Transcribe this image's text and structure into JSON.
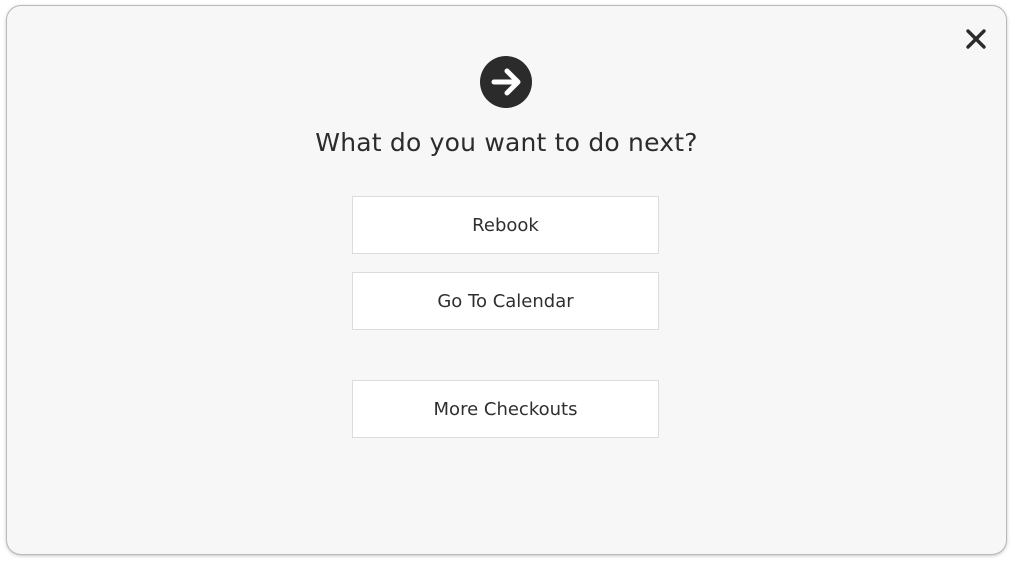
{
  "dialog": {
    "title": "What do you want to do next?",
    "icons": {
      "header": "arrow-right-circle-icon",
      "close": "close-icon"
    },
    "colors": {
      "background": "#f7f7f7",
      "button_background": "#ffffff",
      "icon": "#2b2b2b",
      "text": "#2c2c2c"
    },
    "options": [
      {
        "label": "Rebook"
      },
      {
        "label": "Go To Calendar"
      },
      {
        "label": "More Checkouts"
      }
    ]
  }
}
